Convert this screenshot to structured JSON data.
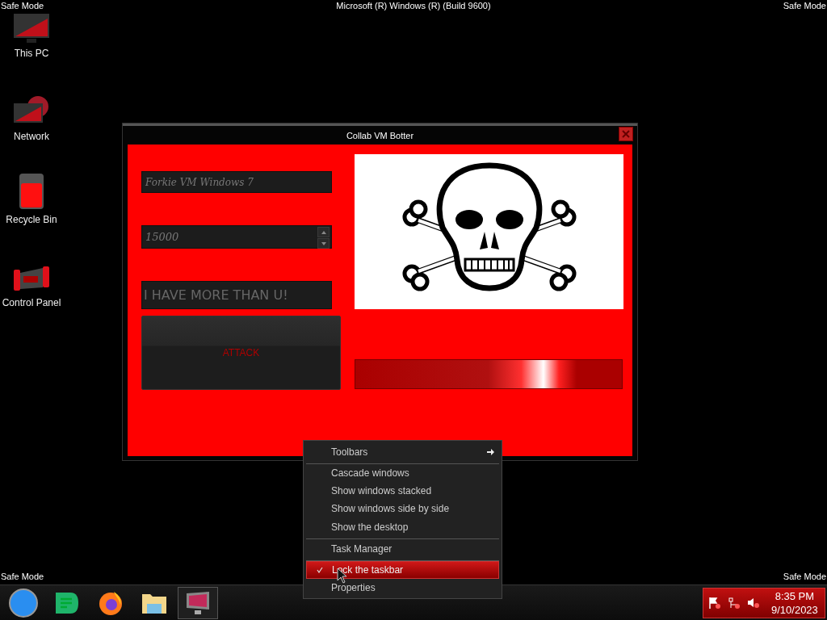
{
  "desktop": {
    "labels": {
      "top_left": "Safe Mode",
      "top_center": "Microsoft (R) Windows (R) (Build 9600)",
      "top_right": "Safe Mode",
      "bottom_left": "Safe Mode",
      "bottom_right": "Safe Mode"
    },
    "icons": [
      {
        "label": "This PC",
        "kind": "computer"
      },
      {
        "label": "Network",
        "kind": "network"
      },
      {
        "label": "Recycle Bin",
        "kind": "bin"
      },
      {
        "label": "Control Panel",
        "kind": "panel"
      }
    ]
  },
  "window": {
    "title": "Collab VM Botter",
    "fields": [
      {
        "kind": "text",
        "value": "Forkie VM Windows 7"
      },
      {
        "kind": "spin",
        "value": "15000"
      },
      {
        "kind": "big",
        "value": "I HAVE MORE THAN U!"
      }
    ],
    "button": "ATTACK",
    "progress": {
      "level": 0.83
    }
  },
  "context_menu": [
    {
      "label": "Toolbars",
      "submenu": true,
      "checked": false,
      "selected": false,
      "separator_after": true
    },
    {
      "label": "Cascade windows",
      "submenu": false,
      "checked": false,
      "selected": false,
      "separator_after": false
    },
    {
      "label": "Show windows stacked",
      "submenu": false,
      "checked": false,
      "selected": false,
      "separator_after": false
    },
    {
      "label": "Show windows side by side",
      "submenu": false,
      "checked": false,
      "selected": false,
      "separator_after": false
    },
    {
      "label": "Show the desktop",
      "submenu": false,
      "checked": false,
      "selected": false,
      "separator_after": true
    },
    {
      "label": "Task Manager",
      "submenu": false,
      "checked": false,
      "selected": false,
      "separator_after": true
    },
    {
      "label": "Lock the taskbar",
      "submenu": false,
      "checked": true,
      "selected": true,
      "separator_after": false
    },
    {
      "label": "Properties",
      "submenu": false,
      "checked": false,
      "selected": false,
      "separator_after": false
    }
  ],
  "taskbar": {
    "apps": [
      {
        "kind": "start",
        "selected": false
      },
      {
        "kind": "chat",
        "selected": false
      },
      {
        "kind": "browser",
        "selected": false
      },
      {
        "kind": "folder",
        "selected": false
      },
      {
        "kind": "display",
        "selected": true
      }
    ],
    "clock": {
      "time": "8:35 PM",
      "date": "9/10/2023"
    }
  }
}
